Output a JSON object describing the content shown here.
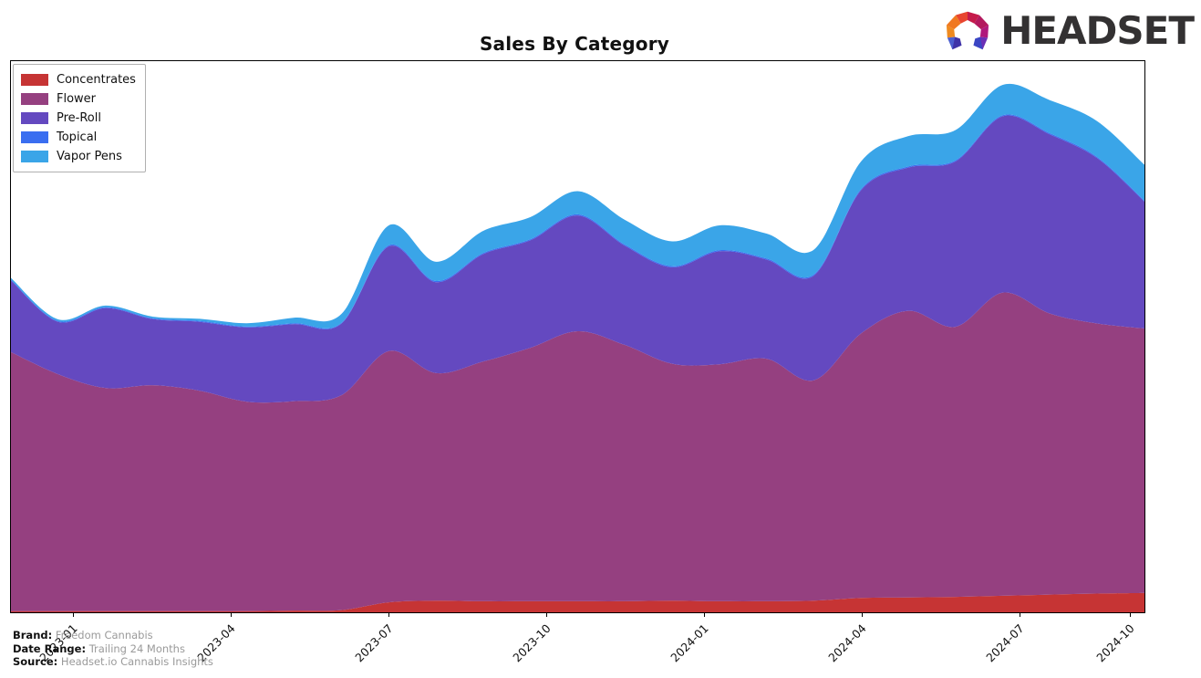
{
  "header": {
    "title": "Sales By Category",
    "logo_text": "HEADSET",
    "logo_mark_name": "headset-hexagon-logo"
  },
  "footer": {
    "rows": [
      {
        "key": "Brand:",
        "value": "Freedom Cannabis"
      },
      {
        "key": "Date Range:",
        "value": "Trailing 24 Months"
      },
      {
        "key": "Source:",
        "value": "Headset.io Cannabis Insights"
      }
    ]
  },
  "colors": {
    "concentrates": "#c63434",
    "flower": "#954080",
    "preroll": "#6449c0",
    "topical": "#3a6ef0",
    "vapor_pens": "#3aa5e8",
    "axis": "#000000",
    "footer_value": "#9a9a9a",
    "title": "#111111"
  },
  "chart_data": {
    "type": "area",
    "stacked": true,
    "title": "Sales By Category",
    "xlabel": "",
    "ylabel": "",
    "grid": false,
    "legend_position": "upper left",
    "smoothing": "spline",
    "x": [
      "2022-11",
      "2022-12",
      "2023-01",
      "2023-02",
      "2023-03",
      "2023-04",
      "2023-05",
      "2023-06",
      "2023-07",
      "2023-08",
      "2023-09",
      "2023-10",
      "2023-11",
      "2023-12",
      "2024-01",
      "2024-02",
      "2024-03",
      "2024-04",
      "2024-05",
      "2024-06",
      "2024-07",
      "2024-08",
      "2024-09",
      "2024-10",
      "2024-11"
    ],
    "xtick_labels": [
      "2023-01",
      "2023-04",
      "2023-07",
      "2023-10",
      "2024-01",
      "2024-04",
      "2024-07",
      "2024-10"
    ],
    "xtick_positions": [
      0.0556,
      0.1945,
      0.3333,
      0.4722,
      0.6111,
      0.75,
      0.8889,
      0.9861
    ],
    "ylim": [
      0,
      100
    ],
    "series": [
      {
        "name": "Concentrates",
        "color": "#c63434",
        "values": [
          0.2,
          0.2,
          0.2,
          0.2,
          0.2,
          0.2,
          0.3,
          0.4,
          1.8,
          2.1,
          2.0,
          2.0,
          2.0,
          2.0,
          2.1,
          2.0,
          2.0,
          2.1,
          2.6,
          2.7,
          2.8,
          3.0,
          3.2,
          3.4,
          3.5
        ]
      },
      {
        "name": "Flower",
        "color": "#954080",
        "values": [
          47.0,
          43.0,
          40.5,
          41.0,
          40.0,
          38.0,
          38.0,
          39.0,
          45.6,
          41.3,
          43.5,
          46.0,
          49.0,
          46.5,
          43.0,
          43.0,
          44.0,
          40.0,
          48.0,
          52.0,
          49.0,
          55.0,
          51.0,
          49.0,
          48.0
        ]
      },
      {
        "name": "Pre-Roll",
        "color": "#6449c0",
        "values": [
          13.0,
          9.5,
          14.5,
          12.0,
          12.5,
          13.5,
          14.0,
          13.0,
          19.0,
          16.5,
          19.5,
          19.5,
          21.0,
          18.0,
          17.5,
          20.5,
          18.0,
          19.0,
          26.0,
          26.0,
          30.0,
          32.0,
          32.5,
          30.0,
          23.0
        ]
      },
      {
        "name": "Topical",
        "color": "#3a6ef0",
        "values": [
          0.15,
          0.15,
          0.15,
          0.15,
          0.15,
          0.15,
          0.15,
          0.15,
          0.2,
          0.2,
          0.2,
          0.2,
          0.2,
          0.2,
          0.2,
          0.2,
          0.2,
          0.2,
          0.2,
          0.2,
          0.2,
          0.2,
          0.2,
          0.2,
          0.2
        ]
      },
      {
        "name": "Vapor Pens",
        "color": "#3aa5e8",
        "values": [
          0.3,
          0.3,
          0.3,
          0.3,
          0.4,
          0.6,
          1.0,
          1.6,
          3.6,
          3.5,
          4.0,
          4.0,
          4.2,
          4.5,
          4.5,
          4.5,
          4.5,
          4.5,
          5.0,
          5.5,
          5.5,
          5.5,
          6.0,
          6.5,
          6.5
        ]
      }
    ]
  }
}
